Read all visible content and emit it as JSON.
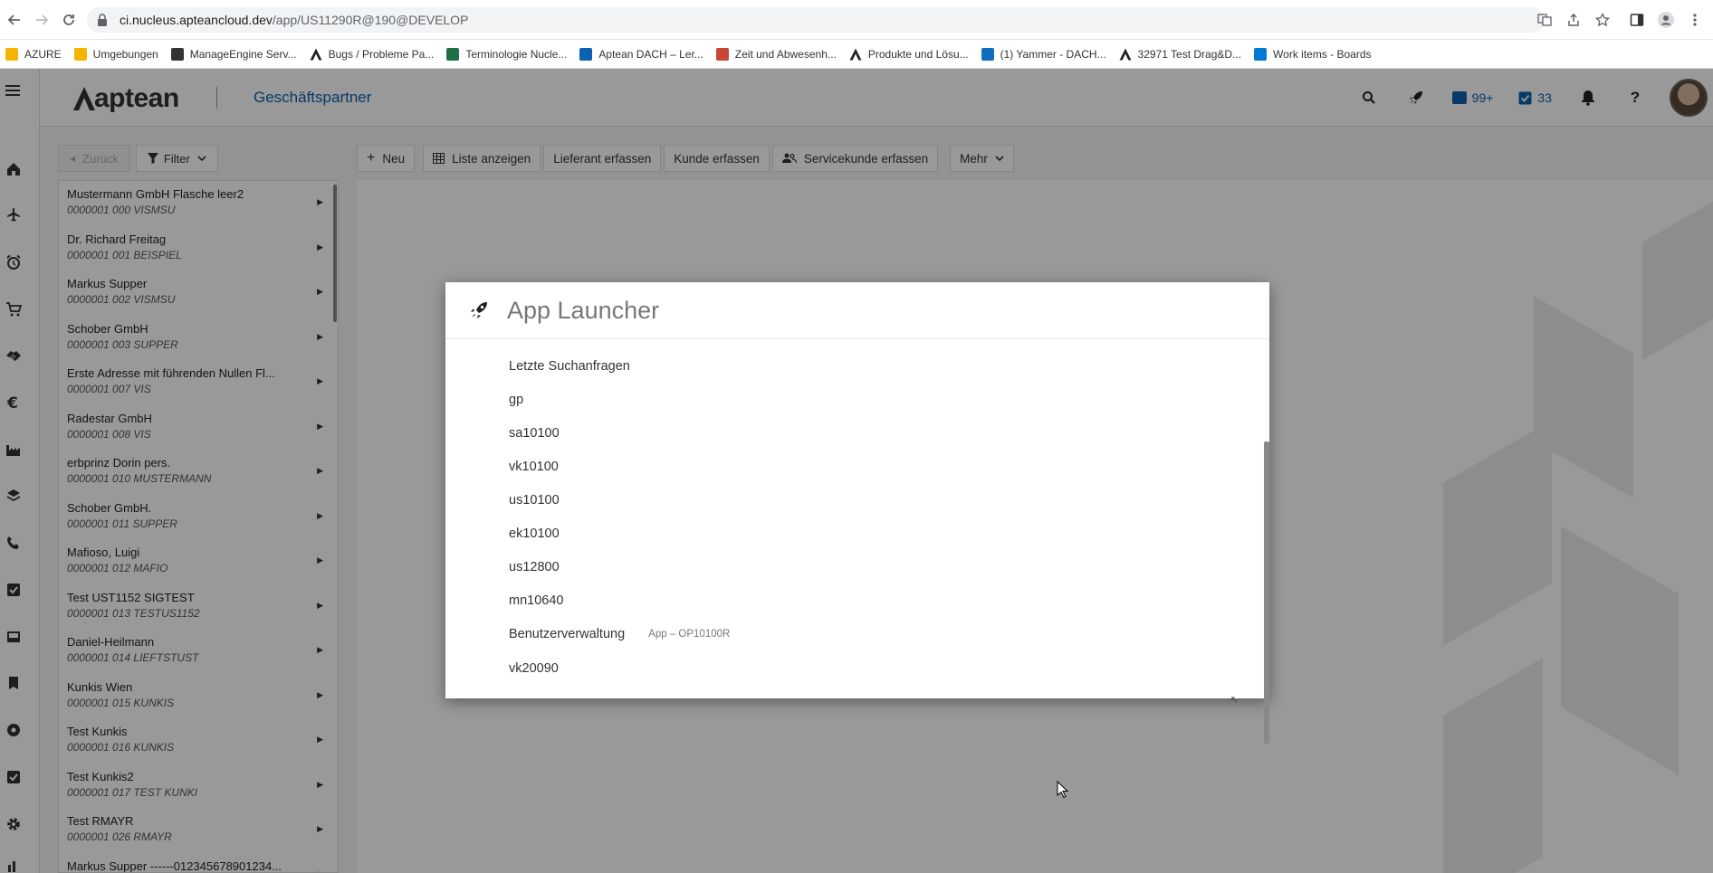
{
  "browser": {
    "url_host": "ci.nucleus.apteancloud.dev",
    "url_path": "/app/US11290R@190@DEVELOP",
    "bookmarks": [
      {
        "label": "AZURE",
        "icon": "folder-icon",
        "color": "#f4b400"
      },
      {
        "label": "Umgebungen",
        "icon": "folder-icon",
        "color": "#f4b400"
      },
      {
        "label": "ManageEngine Serv...",
        "icon": "sd-icon",
        "color": "#333333"
      },
      {
        "label": "Bugs / Probleme Pa...",
        "icon": "aptean-icon",
        "color": "#222222"
      },
      {
        "label": "Terminologie Nucle...",
        "icon": "excel-icon",
        "color": "#1e7145"
      },
      {
        "label": "Aptean DACH – Ler...",
        "icon": "sharepoint-icon",
        "color": "#0a62b0"
      },
      {
        "label": "Zeit und Abwesenh...",
        "icon": "oracle-icon",
        "color": "#c74634"
      },
      {
        "label": "Produkte und Lösu...",
        "icon": "aptean-icon",
        "color": "#222222"
      },
      {
        "label": "(1) Yammer - DACH...",
        "icon": "yammer-icon",
        "color": "#106ebe"
      },
      {
        "label": "32971 Test Drag&D...",
        "icon": "aptean-icon",
        "color": "#222222"
      },
      {
        "label": "Work items - Boards",
        "icon": "devops-icon",
        "color": "#0078d4"
      }
    ]
  },
  "app": {
    "logo": "aptean",
    "title": "Geschäftspartner",
    "badges": {
      "inbox": "99+",
      "tasks": "33"
    },
    "left_toolbar": {
      "back": "Zurück",
      "filter": "Filter"
    },
    "actions": {
      "new": "Neu",
      "show_list": "Liste anzeigen",
      "add_supplier": "Lieferant erfassen",
      "add_customer": "Kunde erfassen",
      "add_service_customer": "Servicekunde erfassen",
      "more": "Mehr"
    },
    "list": [
      {
        "name": "Mustermann GmbH Flasche leer2",
        "sub": "0000001 000 VISMSU"
      },
      {
        "name": "Dr. Richard Freitag",
        "sub": "0000001 001 BEISPIEL"
      },
      {
        "name": "Markus Supper",
        "sub": "0000001 002 VISMSU"
      },
      {
        "name": "Schober GmbH",
        "sub": "0000001 003 SUPPER"
      },
      {
        "name": "Erste Adresse mit führenden Nullen Fl...",
        "sub": "0000001 007 VIS"
      },
      {
        "name": "Radestar GmbH",
        "sub": "0000001 008 VIS"
      },
      {
        "name": "erbprinz Dorin pers.",
        "sub": "0000001 010 MUSTERMANN"
      },
      {
        "name": "Schober GmbH.",
        "sub": "0000001 011 SUPPER"
      },
      {
        "name": "Mafioso, Luigi",
        "sub": "0000001 012 MAFIO"
      },
      {
        "name": "Test UST1152 SIGTEST",
        "sub": "0000001 013 TESTUS1152"
      },
      {
        "name": "Daniel-Heilmann",
        "sub": "0000001 014 LIEFTSTUST"
      },
      {
        "name": "Kunkis Wien",
        "sub": "0000001 015 KUNKIS"
      },
      {
        "name": "Test Kunkis",
        "sub": "0000001 016 KUNKIS"
      },
      {
        "name": "Test Kunkis2",
        "sub": "0000001 017 TEST KUNKI"
      },
      {
        "name": "Test RMAYR",
        "sub": "0000001 026 RMAYR"
      },
      {
        "name": "Markus Supper ------012345678901234...",
        "sub": ""
      }
    ]
  },
  "dialog": {
    "title": "App Launcher",
    "section": "Letzte Suchanfragen",
    "items": [
      {
        "label": "gp",
        "meta": ""
      },
      {
        "label": "sa10100",
        "meta": ""
      },
      {
        "label": "vk10100",
        "meta": ""
      },
      {
        "label": "us10100",
        "meta": ""
      },
      {
        "label": "ek10100",
        "meta": ""
      },
      {
        "label": "us12800",
        "meta": ""
      },
      {
        "label": "mn10640",
        "meta": ""
      },
      {
        "label": "Benutzerverwaltung",
        "meta": "App  –  OP10100R"
      },
      {
        "label": "vk20090",
        "meta": ""
      }
    ],
    "hint_glyph": "↖"
  }
}
